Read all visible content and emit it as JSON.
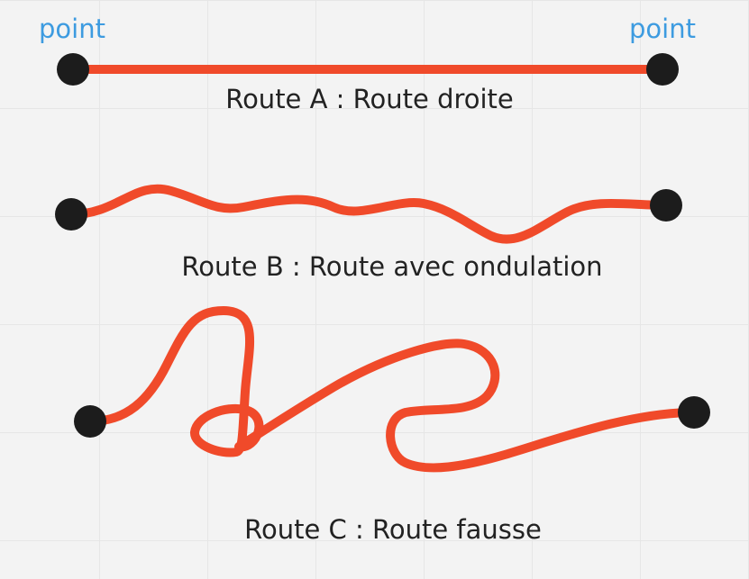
{
  "colors": {
    "route": "#f04a2a",
    "endpoint": "#1c1c1c",
    "point_label": "#3d9be0",
    "text": "#222222"
  },
  "point_labels": {
    "left": "point",
    "right": "point"
  },
  "routes": {
    "a": {
      "label": "Route A : Route droite"
    },
    "b": {
      "label": "Route B : Route avec ondulation"
    },
    "c": {
      "label": "Route C : Route fausse"
    }
  }
}
